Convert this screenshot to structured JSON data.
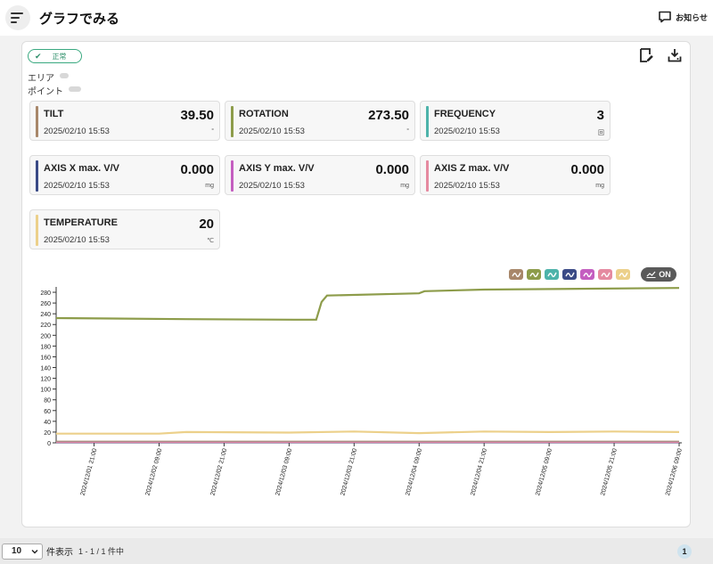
{
  "header": {
    "title": "グラフでみる",
    "notice_label": "お知らせ"
  },
  "status": {
    "label": "正常",
    "color": "#3aa980"
  },
  "meta": {
    "area_label": "エリア",
    "point_label": "ポイント"
  },
  "tiles": [
    {
      "name": "TILT",
      "value": "39.50",
      "time": "2025/02/10 15:53",
      "unit": "°",
      "color": "#a8876a"
    },
    {
      "name": "ROTATION",
      "value": "273.50",
      "time": "2025/02/10 15:53",
      "unit": "°",
      "color": "#8d9c4a"
    },
    {
      "name": "FREQUENCY",
      "value": "3",
      "time": "2025/02/10 15:53",
      "unit": "回",
      "color": "#4db3aa"
    },
    {
      "name": "AXIS X max. V/V",
      "value": "0.000",
      "time": "2025/02/10 15:53",
      "unit": "mg",
      "color": "#3a4a86"
    },
    {
      "name": "AXIS Y max. V/V",
      "value": "0.000",
      "time": "2025/02/10 15:53",
      "unit": "mg",
      "color": "#c45ec0"
    },
    {
      "name": "AXIS Z max. V/V",
      "value": "0.000",
      "time": "2025/02/10 15:53",
      "unit": "mg",
      "color": "#e58aa0"
    },
    {
      "name": "TEMPERATURE",
      "value": "20",
      "time": "2025/02/10 15:53",
      "unit": "℃",
      "color": "#ecd08a"
    }
  ],
  "legend": {
    "toggle_label": "ON"
  },
  "chart_data": {
    "type": "line",
    "ylim": [
      0,
      290
    ],
    "yticks": [
      0,
      20,
      40,
      60,
      80,
      100,
      120,
      140,
      160,
      180,
      200,
      220,
      240,
      260,
      280
    ],
    "x_ticks": [
      "2024/12/01 21:00",
      "2024/12/02 09:00",
      "2024/12/02 21:00",
      "2024/12/03 09:00",
      "2024/12/03 21:00",
      "2024/12/04 09:00",
      "2024/12/04 21:00",
      "2024/12/05 09:00",
      "2024/12/05 21:00",
      "2024/12/06 09:00"
    ],
    "x_range": [
      "2024/12/01 14:00",
      "2024/12/06 09:00"
    ],
    "series": [
      {
        "color": "#8d9c4a",
        "points": [
          [
            "2024/12/01 14:00",
            232
          ],
          [
            "2024/12/02 14:00",
            230
          ],
          [
            "2024/12/03 10:00",
            229
          ],
          [
            "2024/12/03 14:00",
            229
          ],
          [
            "2024/12/03 15:00",
            262
          ],
          [
            "2024/12/03 16:00",
            274
          ],
          [
            "2024/12/04 09:00",
            278
          ],
          [
            "2024/12/04 10:00",
            282
          ],
          [
            "2024/12/04 21:00",
            285
          ],
          [
            "2024/12/06 09:00",
            288
          ]
        ]
      },
      {
        "color": "#ecd08a",
        "points": [
          [
            "2024/12/01 14:00",
            17
          ],
          [
            "2024/12/02 09:00",
            17
          ],
          [
            "2024/12/02 14:00",
            20
          ],
          [
            "2024/12/03 09:00",
            19
          ],
          [
            "2024/12/03 21:00",
            21
          ],
          [
            "2024/12/04 09:00",
            18
          ],
          [
            "2024/12/04 21:00",
            21
          ],
          [
            "2024/12/05 09:00",
            20
          ],
          [
            "2024/12/05 21:00",
            21
          ],
          [
            "2024/12/06 09:00",
            20
          ]
        ]
      },
      {
        "color": "#a8876a",
        "points": [
          [
            "2024/12/01 14:00",
            3
          ],
          [
            "2024/12/06 09:00",
            3
          ]
        ]
      },
      {
        "color": "#4db3aa",
        "points": [
          [
            "2024/12/01 14:00",
            1.5
          ],
          [
            "2024/12/06 09:00",
            1.5
          ]
        ]
      },
      {
        "color": "#3a4a86",
        "points": [
          [
            "2024/12/01 14:00",
            0.5
          ],
          [
            "2024/12/06 09:00",
            0.5
          ]
        ]
      },
      {
        "color": "#c45ec0",
        "points": [
          [
            "2024/12/01 14:00",
            0.8
          ],
          [
            "2024/12/06 09:00",
            0.8
          ]
        ]
      },
      {
        "color": "#e58aa0",
        "points": [
          [
            "2024/12/01 14:00",
            1.1
          ],
          [
            "2024/12/06 09:00",
            1.1
          ]
        ]
      }
    ]
  },
  "footer": {
    "per_page_value": "10",
    "per_page_label": "件表示",
    "range_text": "1 - 1 / 1 件中",
    "current_page": "1"
  }
}
